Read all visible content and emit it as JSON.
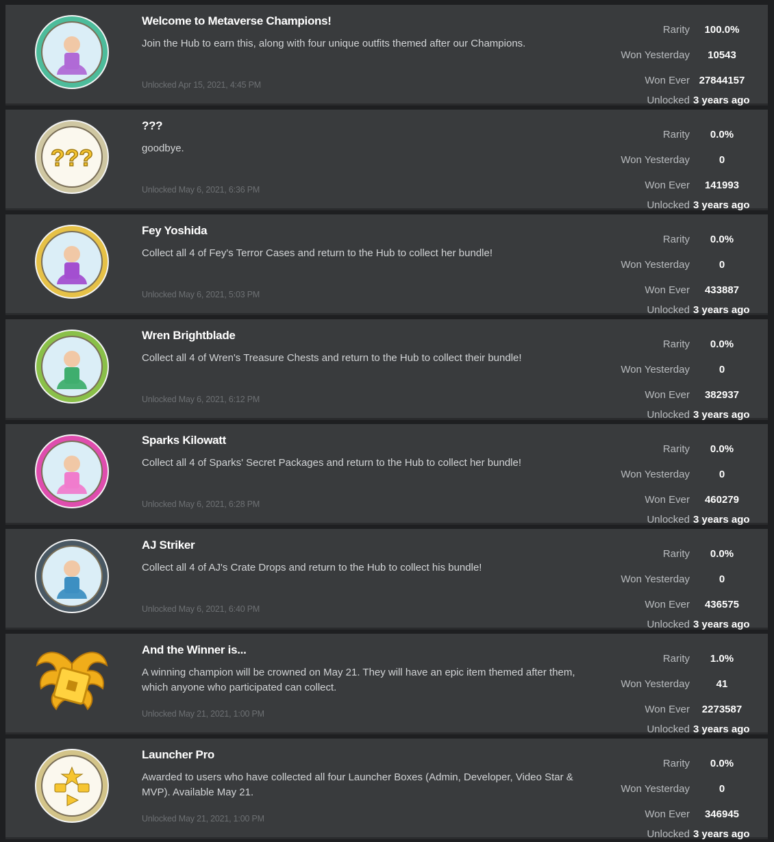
{
  "stat_labels": {
    "rarity": "Rarity",
    "won_yesterday": "Won Yesterday",
    "won_ever": "Won Ever",
    "unlocked": "Unlocked"
  },
  "badges": [
    {
      "title": "Welcome to Metaverse Champions!",
      "description": "Join the Hub to earn this, along with four unique outfits themed after our Champions.",
      "date": "Unlocked Apr 15, 2021, 4:45 PM",
      "rarity": "100.0%",
      "won_yesterday": "10543",
      "won_ever": "27844157",
      "unlocked_ago": "3 years ago",
      "icon": "champions-group-badge-icon",
      "colors": {
        "ring": "#4fc3a1",
        "inner": "#b06ad6"
      }
    },
    {
      "title": "???",
      "description": "goodbye.",
      "date": "Unlocked May 6, 2021, 6:36 PM",
      "rarity": "0.0%",
      "won_yesterday": "0",
      "won_ever": "141993",
      "unlocked_ago": "3 years ago",
      "icon": "question-marks-badge-icon",
      "colors": {
        "ring": "#d8cfa8",
        "inner": "#f6f3e6"
      }
    },
    {
      "title": "Fey Yoshida",
      "description": "Collect all 4 of Fey's Terror Cases and return to the Hub to collect her bundle!",
      "date": "Unlocked May 6, 2021, 5:03 PM",
      "rarity": "0.0%",
      "won_yesterday": "0",
      "won_ever": "433887",
      "unlocked_ago": "3 years ago",
      "icon": "fey-yoshida-badge-icon",
      "colors": {
        "ring": "#f0c948",
        "inner": "#a34fd0"
      }
    },
    {
      "title": "Wren Brightblade",
      "description": "Collect all 4 of Wren's Treasure Chests and return to the Hub to collect their bundle!",
      "date": "Unlocked May 6, 2021, 6:12 PM",
      "rarity": "0.0%",
      "won_yesterday": "0",
      "won_ever": "382937",
      "unlocked_ago": "3 years ago",
      "icon": "wren-brightblade-badge-icon",
      "colors": {
        "ring": "#8fc84a",
        "inner": "#3fae6e"
      }
    },
    {
      "title": "Sparks Kilowatt",
      "description": "Collect all 4 of Sparks' Secret Packages and return to the Hub to collect her bundle!",
      "date": "Unlocked May 6, 2021, 6:28 PM",
      "rarity": "0.0%",
      "won_yesterday": "0",
      "won_ever": "460279",
      "unlocked_ago": "3 years ago",
      "icon": "sparks-kilowatt-badge-icon",
      "colors": {
        "ring": "#e84fb5",
        "inner": "#f07ccd"
      }
    },
    {
      "title": "AJ Striker",
      "description": "Collect all 4 of AJ's Crate Drops and return to the Hub to collect his bundle!",
      "date": "Unlocked May 6, 2021, 6:40 PM",
      "rarity": "0.0%",
      "won_yesterday": "0",
      "won_ever": "436575",
      "unlocked_ago": "3 years ago",
      "icon": "aj-striker-badge-icon",
      "colors": {
        "ring": "#4a5a66",
        "inner": "#3d8fc2"
      }
    },
    {
      "title": "And the Winner is...",
      "description": "A winning champion will be crowned on May 21. They will have an epic item themed after them, which anyone who participated can collect.",
      "date": "Unlocked May 21, 2021, 1:00 PM",
      "rarity": "1.0%",
      "won_yesterday": "41",
      "won_ever": "2273587",
      "unlocked_ago": "3 years ago",
      "icon": "golden-wings-badge-icon",
      "colors": {
        "ring": "#f2b51c",
        "inner": "#ffd23f"
      }
    },
    {
      "title": "Launcher Pro",
      "description": "Awarded to users who have collected all four Launcher Boxes (Admin, Developer, Video Star & MVP). Available May 21.",
      "date": "Unlocked May 21, 2021, 1:00 PM",
      "rarity": "0.0%",
      "won_yesterday": "0",
      "won_ever": "346945",
      "unlocked_ago": "3 years ago",
      "icon": "launcher-pro-badge-icon",
      "colors": {
        "ring": "#dccc8e",
        "inner": "#f6f1dc"
      }
    }
  ]
}
